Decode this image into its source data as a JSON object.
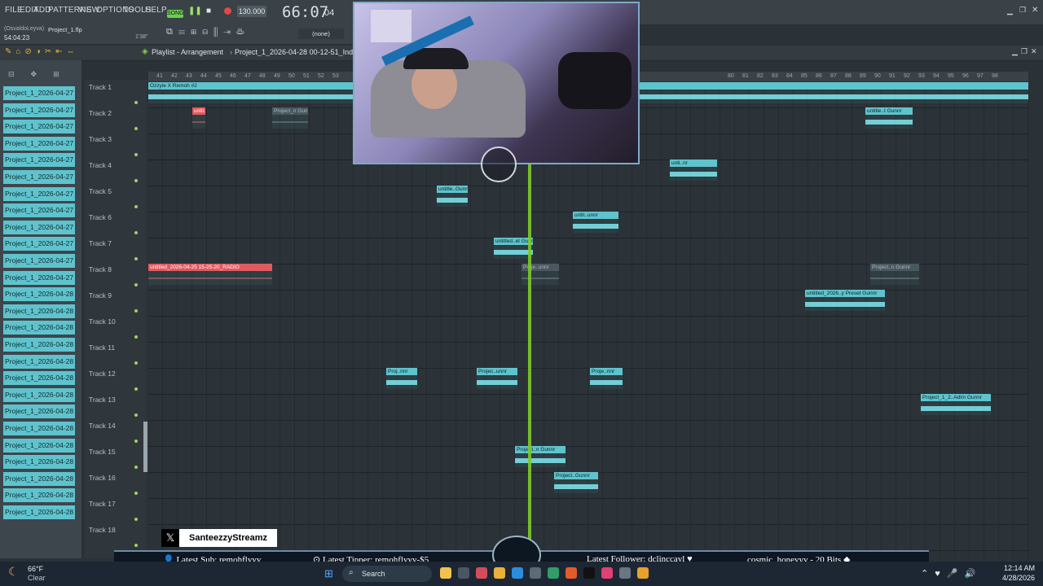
{
  "menu": [
    "FILE",
    "EDIT",
    "ADD",
    "PATTERNS",
    "VIEW",
    "OPTIONS",
    "TOOLS",
    "HELP"
  ],
  "transport": {
    "mode": "SONG",
    "tempo": "130.000",
    "time": "66:07",
    "time_sub": "04"
  },
  "project": {
    "user": "(OsvaldoLeyva)",
    "file": "Project_1.flp",
    "elapsed": "54:04:23",
    "hint": "1'38\""
  },
  "snap": "(none)",
  "playlist_title": "Playlist - Arrangement",
  "playlist_path": "Project_1_2026-04-28 00-12-51_Ind",
  "browser_items": [
    "Project_1_2026-04-27 2...",
    "Project_1_2026-04-27 2...",
    "Project_1_2026-04-27 2...",
    "Project_1_2026-04-27 2...",
    "Project_1_2026-04-27 2...",
    "Project_1_2026-04-27 2...",
    "Project_1_2026-04-27 2...",
    "Project_1_2026-04-27 2...",
    "Project_1_2026-04-27 2...",
    "Project_1_2026-04-27 2...",
    "Project_1_2026-04-27 2...",
    "Project_1_2026-04-27 2...",
    "Project_1_2026-04-28 0...",
    "Project_1_2026-04-28 0...",
    "Project_1_2026-04-28 0...",
    "Project_1_2026-04-28 0...",
    "Project_1_2026-04-28 0...",
    "Project_1_2026-04-28 0...",
    "Project_1_2026-04-28 0...",
    "Project_1_2026-04-28 0...",
    "Project_1_2026-04-28 0...",
    "Project_1_2026-04-28 0...",
    "Project_1_2026-04-28 0...",
    "Project_1_2026-04-28 0...",
    "Project_1_2026-04-28 0...",
    "Project_1_2026-04-28 0..."
  ],
  "tracks": [
    "Track 1",
    "Track 2",
    "Track 3",
    "Track 4",
    "Track 5",
    "Track 6",
    "Track 7",
    "Track 8",
    "Track 9",
    "Track 10",
    "Track 11",
    "Track 12",
    "Track 13",
    "Track 14",
    "Track 15",
    "Track 16",
    "Track 17",
    "Track 18"
  ],
  "ruler_nums": [
    "41",
    "42",
    "43",
    "44",
    "45",
    "46",
    "47",
    "48",
    "49",
    "50",
    "51",
    "52",
    "53",
    "80",
    "81",
    "82",
    "83",
    "84",
    "85",
    "86",
    "87",
    "88",
    "89",
    "90",
    "91",
    "92",
    "93",
    "94",
    "95",
    "96",
    "97",
    "98"
  ],
  "clips": [
    {
      "label": "Ozzyie X Remoh #2",
      "kind": "normal"
    },
    {
      "label": "untit..ADIO",
      "kind": "red"
    },
    {
      "label": "Project_n Gunnr",
      "kind": "dim"
    },
    {
      "label": "untitle..t Gunnr",
      "kind": "normal"
    },
    {
      "label": "unti..nr",
      "kind": "normal"
    },
    {
      "label": "untitle..Gunnr",
      "kind": "normal"
    },
    {
      "label": "untit..unnr",
      "kind": "normal"
    },
    {
      "label": "untitled..et Gunnr",
      "kind": "normal"
    },
    {
      "label": "untitled_2026-04-25 15-25-20_RADIO",
      "kind": "red"
    },
    {
      "label": "Proje..unnr",
      "kind": "dim"
    },
    {
      "label": "Project..n Gunnr",
      "kind": "dim"
    },
    {
      "label": "untitled_2026..y Preset Gunnr",
      "kind": "normal"
    },
    {
      "label": "Proj..nnr",
      "kind": "normal"
    },
    {
      "label": "Projec..unnr",
      "kind": "normal"
    },
    {
      "label": "Proje..nnr",
      "kind": "normal"
    },
    {
      "label": "Project_1_2..Adlm Gunnr",
      "kind": "normal"
    },
    {
      "label": "Project..n Gunnr",
      "kind": "normal"
    },
    {
      "label": "Project..Gunnr",
      "kind": "normal"
    }
  ],
  "overlay": {
    "twitter": "SanteezzyStreamz",
    "sub": "Latest Sub: remohflyyy",
    "tipper": "Latest Tipper: remohflyyy-$5",
    "follower": "Latest Follower: dclinccayl",
    "bits": "cosmic_honeyyy - 20 Bits"
  },
  "taskbar": {
    "temp": "66°F",
    "weather": "Clear",
    "search": "Search",
    "time": "12:14 AM",
    "date": "4/28/2026"
  }
}
